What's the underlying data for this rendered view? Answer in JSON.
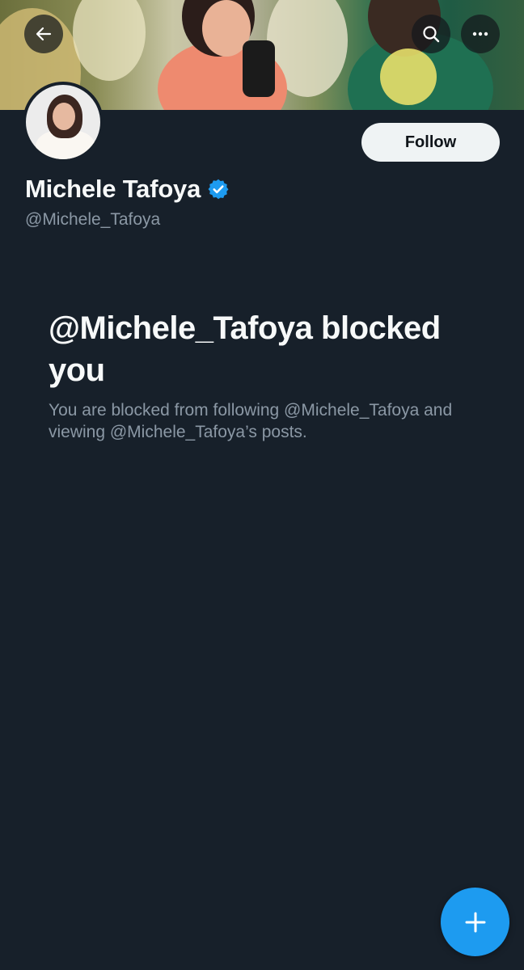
{
  "header": {
    "back_icon": "arrow-left-icon",
    "search_icon": "search-icon",
    "more_icon": "ellipsis-icon"
  },
  "profile": {
    "display_name": "Michele Tafoya",
    "handle": "@Michele_Tafoya",
    "verified_icon": "verified-badge-icon",
    "verified_color": "#1d9bf0",
    "follow_label": "Follow"
  },
  "blocked": {
    "title": "@Michele_Tafoya blocked you",
    "message": "You are blocked from following @Michele_Tafoya and viewing @Michele_Tafoya’s posts."
  },
  "fab": {
    "icon": "plus-icon",
    "color": "#1d9bf0"
  },
  "colors": {
    "background": "#17202a",
    "primary_text": "#f7f9f9",
    "secondary_text": "#8b98a5"
  }
}
